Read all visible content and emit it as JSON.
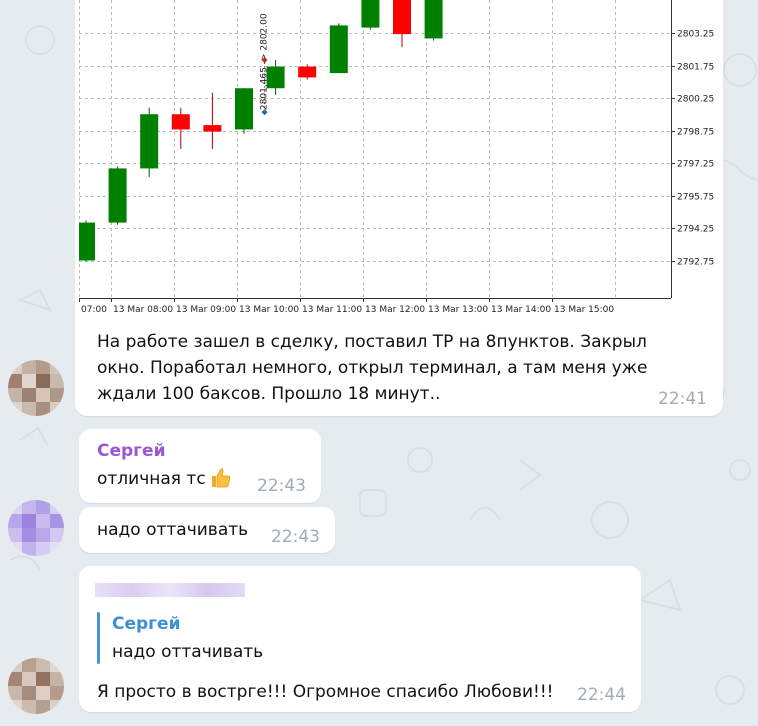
{
  "colors": {
    "bg": "#e5ebef",
    "bubble": "#ffffff",
    "time": "#a2acb4",
    "bull": "#008000",
    "bear": "#ff0000",
    "sender_purple": "#9b57d3",
    "sender_blue": "#3d8fd1"
  },
  "chart_data": {
    "type": "candlestick",
    "x_ticks": [
      "07:00",
      "13 Mar 08:00",
      "13 Mar 09:00",
      "13 Mar 10:00",
      "13 Mar 11:00",
      "13 Mar 12:00",
      "13 Mar 13:00",
      "13 Mar 14:00",
      "13 Mar 15:00"
    ],
    "y_ticks": [
      "2803.25",
      "2801.75",
      "2800.25",
      "2798.75",
      "2797.25",
      "2795.75",
      "2794.25",
      "2792.75"
    ],
    "ylim": [
      2792.0,
      2805.0
    ],
    "candles": [
      {
        "open": 2792.75,
        "close": 2794.5,
        "high": 2794.6,
        "low": 2792.7
      },
      {
        "open": 2794.5,
        "close": 2797.0,
        "high": 2797.1,
        "low": 2794.4
      },
      {
        "open": 2797.0,
        "close": 2799.5,
        "high": 2799.8,
        "low": 2796.6
      },
      {
        "open": 2799.5,
        "close": 2798.8,
        "high": 2799.8,
        "low": 2797.9
      },
      {
        "open": 2799.0,
        "close": 2798.7,
        "high": 2800.5,
        "low": 2797.9
      },
      {
        "open": 2798.8,
        "close": 2800.7,
        "high": 2800.7,
        "low": 2798.6
      },
      {
        "open": 2800.7,
        "close": 2801.7,
        "high": 2802.0,
        "low": 2800.4
      },
      {
        "open": 2801.7,
        "close": 2801.2,
        "high": 2801.8,
        "low": 2801.1
      },
      {
        "open": 2801.4,
        "close": 2803.6,
        "high": 2803.7,
        "low": 2801.4
      },
      {
        "open": 2803.5,
        "close": 2804.8,
        "high": 2805.0,
        "low": 2803.4
      },
      {
        "open": 2805.0,
        "close": 2803.2,
        "high": 2805.0,
        "low": 2802.6
      },
      {
        "open": 2803.0,
        "close": 2805.0,
        "high": 2805.0,
        "low": 2802.9
      }
    ],
    "annotation": "2801.465 -> 2802.00"
  },
  "messages": [
    {
      "text_lines": [
        "На работе зашел в сделку, поставил TP на 8пунктов. Закрыл",
        "окно. Поработал немного, открыл терминал, а там меня уже",
        "ждали 100 баксов. Прошло 18 минут.."
      ],
      "time": "22:41"
    },
    {
      "sender": "Сергей",
      "text": "отличная тс",
      "emoji": "thumbs-up",
      "time": "22:43"
    },
    {
      "text": "надо оттачивать",
      "time": "22:43"
    },
    {
      "reply": {
        "sender": "Сергей",
        "text": "надо оттачивать"
      },
      "text": "Я просто в вострге!!! Огромное спасибо Любови!!!",
      "time": "22:44"
    }
  ]
}
